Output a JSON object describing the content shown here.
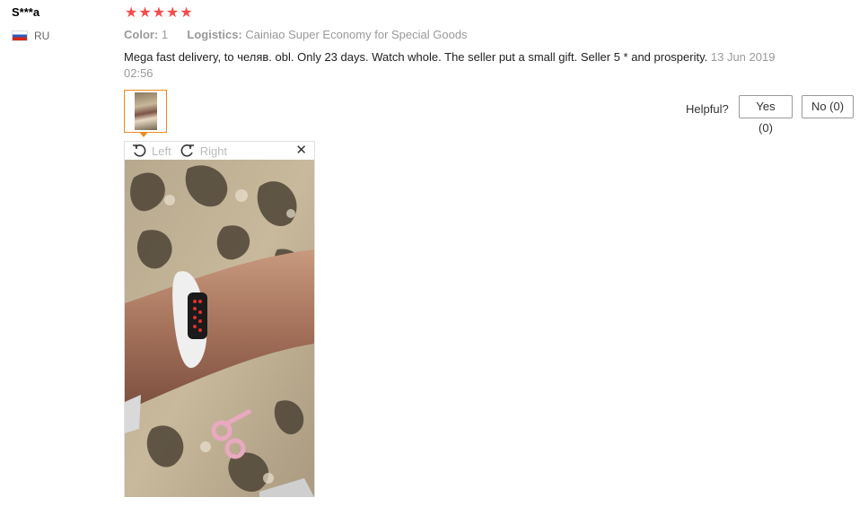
{
  "reviewer": {
    "name": "S***a",
    "country": "RU"
  },
  "rating": {
    "stars": 5,
    "max": 5,
    "color": "#f44d4d"
  },
  "meta": {
    "color_label": "Color:",
    "color_value": "1",
    "logistics_label": "Logistics:",
    "logistics_value": "Cainiao Super Economy for Special Goods"
  },
  "review": {
    "text": "Mega fast delivery, to челяв. obl. Only 23 days. Watch whole. The seller put a small gift. Seller 5 * and prosperity.",
    "date": "13 Jun 2019 02:56"
  },
  "feedback": {
    "helpful_label": "Helpful?",
    "yes_label": "Yes (0)",
    "no_label": "No (0)"
  },
  "viewer": {
    "rotate_left_label": "Left",
    "rotate_right_label": "Right",
    "close_symbol": "✕"
  },
  "colors": {
    "accent": "#f0891f",
    "star": "#f44d4d",
    "watch_display": "#e0322a"
  }
}
